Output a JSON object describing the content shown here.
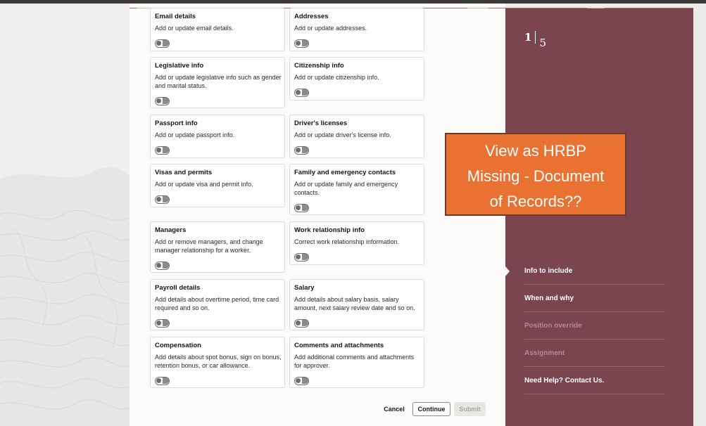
{
  "progress": {
    "current": "1",
    "total": "5"
  },
  "cards": [
    {
      "title": "Email details",
      "desc": "Add or update email details."
    },
    {
      "title": "Addresses",
      "desc": "Add or update addresses."
    },
    {
      "title": "Legislative info",
      "desc": "Add or update legislative info such as gender and marital status."
    },
    {
      "title": "Citizenship info",
      "desc": "Add or update citizenship info."
    },
    {
      "title": "Passport info",
      "desc": "Add or update passport info."
    },
    {
      "title": "Driver's licenses",
      "desc": "Add or update driver's license info."
    },
    {
      "title": "Visas and permits",
      "desc": "Add or update visa and permit info."
    },
    {
      "title": "Family and emergency contacts",
      "desc": "Add or update family and emergency contacts."
    },
    {
      "title": "Managers",
      "desc": "Add or remove managers, and change manager relationship for a worker."
    },
    {
      "title": "Work relationship info",
      "desc": "Correct work relationship information."
    },
    {
      "title": "Payroll details",
      "desc": "Add details about overtime period, time card required and so on."
    },
    {
      "title": "Salary",
      "desc": "Add details about salary basis, salary amount, next salary review date and so on."
    },
    {
      "title": "Compensation",
      "desc": "Add details about spot bonus, sign on bonus, retention bonus, or car allowance."
    },
    {
      "title": "Comments and attachments",
      "desc": "Add additional comments and attachments for approver."
    }
  ],
  "nav": [
    {
      "label": "Info to include"
    },
    {
      "label": "When and why"
    },
    {
      "label": "Position override"
    },
    {
      "label": "Assignment"
    },
    {
      "label": "Need Help? Contact Us."
    }
  ],
  "buttons": {
    "cancel": "Cancel",
    "continue": "Continue",
    "submit": "Submit"
  },
  "callout": {
    "line1": "View as HRBP",
    "line2": "Missing - Document",
    "line3": "of Records??"
  },
  "colors": {
    "side_panel": "#7b4550",
    "callout": "#e97132"
  }
}
